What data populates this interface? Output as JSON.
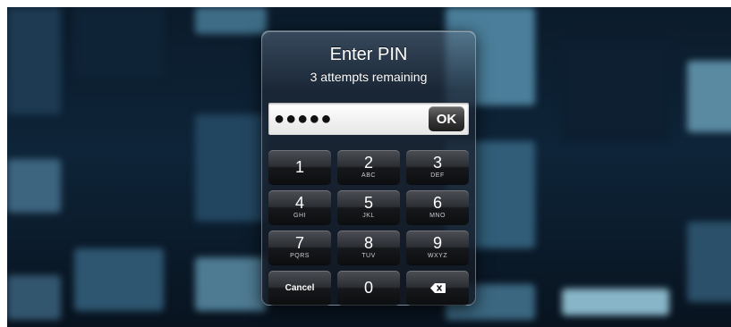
{
  "dialog": {
    "title": "Enter PIN",
    "subtitle": "3 attempts remaining",
    "pin_masked": "●●●●●",
    "ok_label": "OK"
  },
  "keypad": {
    "keys": [
      {
        "num": "1",
        "letters": ""
      },
      {
        "num": "2",
        "letters": "ABC"
      },
      {
        "num": "3",
        "letters": "DEF"
      },
      {
        "num": "4",
        "letters": "GHI"
      },
      {
        "num": "5",
        "letters": "JKL"
      },
      {
        "num": "6",
        "letters": "MNO"
      },
      {
        "num": "7",
        "letters": "PQRS"
      },
      {
        "num": "8",
        "letters": "TUV"
      },
      {
        "num": "9",
        "letters": "WXYZ"
      }
    ],
    "cancel_label": "Cancel",
    "zero": "0",
    "backspace_icon": "backspace-icon"
  },
  "colors": {
    "background": "#0e2438",
    "key_dark": "#16181b",
    "ok_button": "#3a3a3a"
  }
}
